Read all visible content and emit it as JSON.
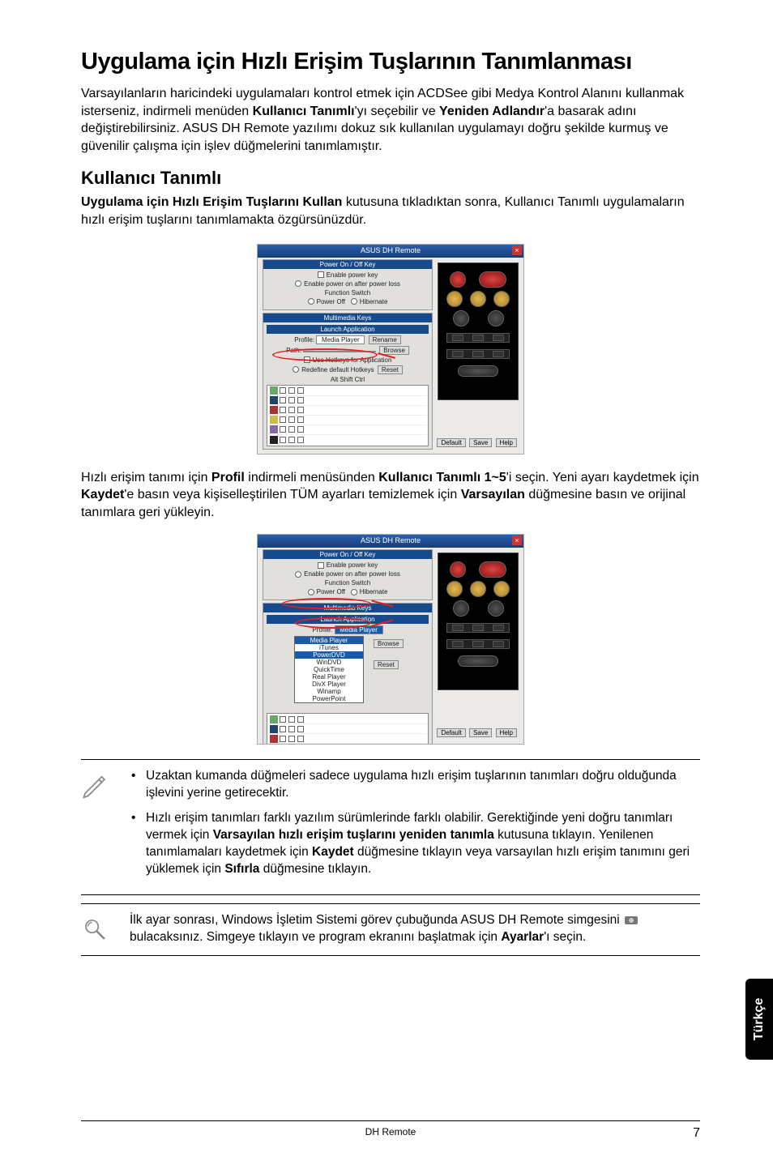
{
  "title": "Uygulama için Hızlı Erişim Tuşlarının Tanımlanması",
  "intro": {
    "pre1": "Varsayılanların haricindeki uygulamaları kontrol etmek için ACDSee gibi Medya Kontrol Alanını kullanmak isterseniz, indirmeli menüden ",
    "b1": "Kullanıcı Tanımlı",
    "mid1": "'yı seçebilir ve ",
    "b2": "Yeniden Adlandır",
    "post1": "'a basarak adını değiştirebilirsiniz. ASUS DH Remote yazılımı dokuz sık kullanılan uygulamayı doğru şekilde kurmuş ve güvenilir çalışma için işlev düğmelerini tanımlamıştır."
  },
  "sub_title": "Kullanıcı Tanımlı",
  "sub_intro": {
    "b1": "Uygulama için Hızlı Erişim Tuşlarını Kullan",
    "post": " kutusuna tıkladıktan sonra, Kullanıcı Tanımlı uygulamaların hızlı erişim tuşlarını tanımlamakta özgürsünüzdür."
  },
  "shot1": {
    "title": "ASUS DH Remote",
    "sec1_hdr": "Power On / Off Key",
    "sec1_l1": "Enable power key",
    "sec1_l2": "Enable power on after power loss",
    "sec1_l3": "Function Switch",
    "sec1_l4a": "Power Off",
    "sec1_l4b": "Hibernate",
    "sec2_hdr": "Multimedia Keys",
    "sec2_sub": "Launch Application",
    "sec2_profile_lbl": "Profile:",
    "sec2_profile_val": "Media Player",
    "sec2_rename": "Rename",
    "sec2_path_lbl": "Path:",
    "sec2_browse": "Browse",
    "sec2_usehot": "Use Hotkeys for Application",
    "sec2_reset": "Reset",
    "sec2_reset_line": "Redefine default Hotkeys",
    "sec2_alt": "Alt Shift Ctrl",
    "btn_default": "Default",
    "btn_save": "Save",
    "btn_help": "Help"
  },
  "mid_para": {
    "pre": "Hızlı erişim tanımı için ",
    "b1": "Profil",
    "mid1": " indirmeli menüsünden ",
    "b2": "Kullanıcı Tanımlı 1~5",
    "mid2": "'i seçin. Yeni ayarı kaydetmek için ",
    "b3": "Kaydet",
    "mid3": "'e basın veya kişiselleştirilen TÜM ayarları temizlemek için ",
    "b4": "Varsayılan",
    "post": " düğmesine basın ve orijinal tanımlara geri yükleyin."
  },
  "shot2": {
    "title": "ASUS DH Remote",
    "dd_items": [
      "Media Player",
      "iTunes",
      "PowerDVD",
      "WinDVD",
      "QuickTime",
      "Real Player",
      "DivX Player",
      "Winamp",
      "PowerPoint"
    ],
    "browse": "Browse",
    "reset": "Reset"
  },
  "note1": {
    "li1": "Uzaktan kumanda düğmeleri sadece uygulama hızlı erişim tuşlarının tanımları doğru olduğunda işlevini yerine getirecektir.",
    "li2_pre": "Hızlı erişim tanımları farklı yazılım sürümlerinde farklı olabilir. Gerektiğinde yeni doğru tanımları vermek için ",
    "li2_b1": "Varsayılan hızlı erişim tuşlarını yeniden tanımla",
    "li2_mid1": " kutusuna tıklayın. Yenilenen tanımlamaları kaydetmek için ",
    "li2_b2": "Kaydet",
    "li2_mid2": " düğmesine tıklayın veya varsayılan hızlı erişim tanımını geri yüklemek için ",
    "li2_b3": "Sıfırla",
    "li2_post": " düğmesine tıklayın."
  },
  "note2": {
    "pre": "İlk ayar sonrası, Windows İşletim Sistemi görev çubuğunda ASUS DH Remote simgesini ",
    "mid": " bulacaksınız. Simgeye tıklayın ve program ekranını başlatmak için ",
    "b1": "Ayarlar",
    "post": "'ı seçin."
  },
  "side_tab": "Türkçe",
  "footer_center": "DH Remote",
  "footer_page": "7"
}
